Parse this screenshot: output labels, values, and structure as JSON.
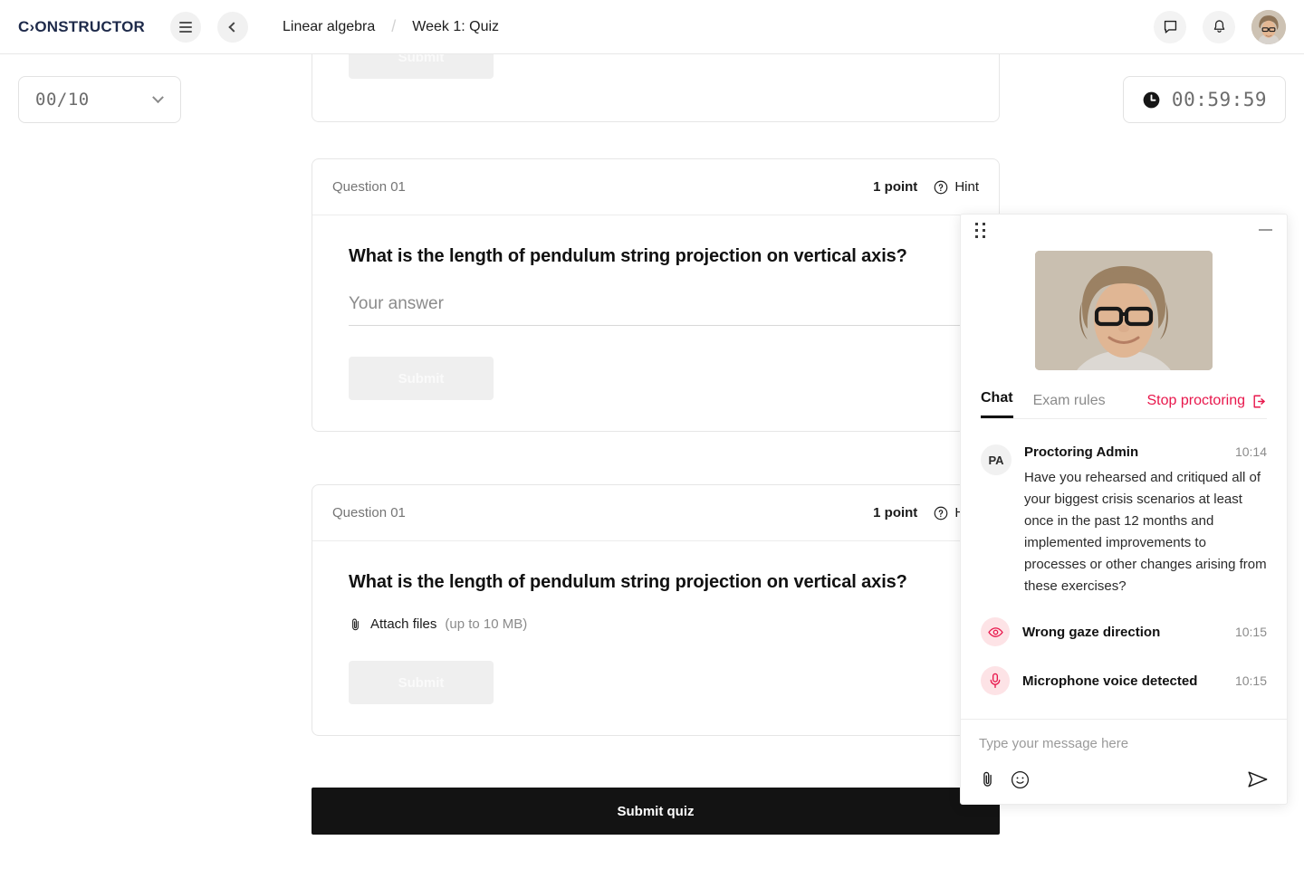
{
  "brand": {
    "name": "C›ONSTRUCTOR",
    "accent": "#e8174c",
    "navy": "#1e2a4a"
  },
  "topbar": {
    "menu_icon": "hamburger-icon",
    "back_icon": "chevron-left-icon",
    "breadcrumb": {
      "course": "Linear algebra",
      "separator": "/",
      "page": "Week 1: Quiz"
    },
    "chat_icon": "chat-bubble-icon",
    "bell_icon": "bell-icon",
    "avatar": "user-avatar"
  },
  "question_select": {
    "value": "00/10",
    "caret_icon": "chevron-down-icon"
  },
  "timer": {
    "clock_icon": "clock-icon",
    "value": "00:59:59"
  },
  "quiz": {
    "cut_card": {
      "submit_label": "Submit"
    },
    "questions": [
      {
        "number": "Question 01",
        "points": "1 point",
        "hint_label": "Hint",
        "hint_icon": "question-circle-icon",
        "title": "What is the length of pendulum string projection on vertical axis?",
        "answer_placeholder": "Your answer",
        "submit_label": "Submit",
        "input_type": "text"
      },
      {
        "number": "Question 01",
        "points": "1 point",
        "hint_label": "Hint",
        "hint_icon": "question-circle-icon",
        "title": "What is the length of pendulum string projection on vertical axis?",
        "attach_label": "Attach files",
        "attach_hint": "(up to 10 MB)",
        "attach_icon": "paperclip-icon",
        "submit_label": "Submit",
        "input_type": "file"
      }
    ],
    "submit_quiz_label": "Submit quiz"
  },
  "proctoring": {
    "drag_icon": "drag-handle-icon",
    "minimize_icon": "minimize-icon",
    "webcam_alt": "proctoring-webcam-feed",
    "tabs": [
      {
        "label": "Chat",
        "active": true
      },
      {
        "label": "Exam rules",
        "active": false
      }
    ],
    "stop_label": "Stop proctoring",
    "stop_icon": "logout-icon",
    "messages": [
      {
        "initials": "PA",
        "author": "Proctoring Admin",
        "time": "10:14",
        "text": "Have you rehearsed and critiqued all of your biggest crisis scenarios at least once in the past 12 months and implemented improvements to processes or other changes arising from these exercises?"
      }
    ],
    "events": [
      {
        "icon": "eye-icon",
        "label": "Wrong gaze direction",
        "time": "10:15"
      },
      {
        "icon": "microphone-icon",
        "label": "Microphone voice detected",
        "time": "10:15"
      }
    ],
    "composer": {
      "placeholder": "Type your message here",
      "attach_icon": "paperclip-icon",
      "emoji_icon": "smiley-icon",
      "send_icon": "send-icon"
    }
  }
}
